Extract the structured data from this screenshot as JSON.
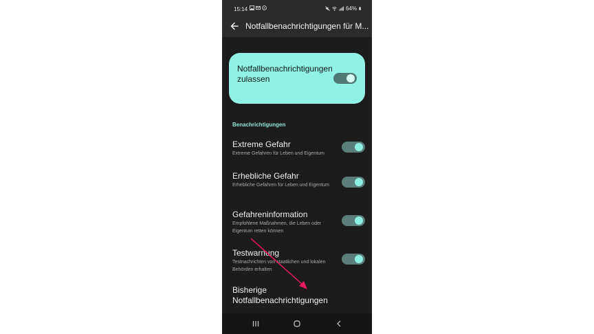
{
  "statusbar": {
    "time": "15:14",
    "left_icons": [
      "image-icon",
      "mail-icon",
      "whatsapp-icon"
    ],
    "right_icons": [
      "mute-icon",
      "wifi-icon",
      "signal-icon"
    ],
    "battery": "64%"
  },
  "appbar": {
    "title": "Notfallbenachrichtigungen für M..."
  },
  "master": {
    "label": "Notfallbenachrichtigungen zulassen",
    "enabled": true
  },
  "section": {
    "title": "Benachrichtigungen"
  },
  "items": [
    {
      "title": "Extreme Gefahr",
      "desc": "Extreme Gefahren für Leben und Eigentum",
      "enabled": true
    },
    {
      "title": "Erhebliche Gefahr",
      "desc": "Erhebliche Gefahren für Leben und Eigentum",
      "enabled": true
    },
    {
      "title": "Gefahreninformation",
      "desc": "Empfohlene Maßnahmen, die Leben oder Eigentum retten können",
      "enabled": true
    },
    {
      "title": "Testwarnung",
      "desc": "Testnachrichten von staatlichen und lokalen Behörden erhalten",
      "enabled": true
    }
  ],
  "history": {
    "label": "Bisherige Notfallbenachrichtigungen"
  },
  "navbar": {
    "buttons": [
      "recent-apps-icon",
      "home-icon",
      "back-icon"
    ]
  },
  "colors": {
    "accent": "#91f1e3",
    "annotation_arrow": "#e8195f",
    "background": "#1c1c1c"
  }
}
